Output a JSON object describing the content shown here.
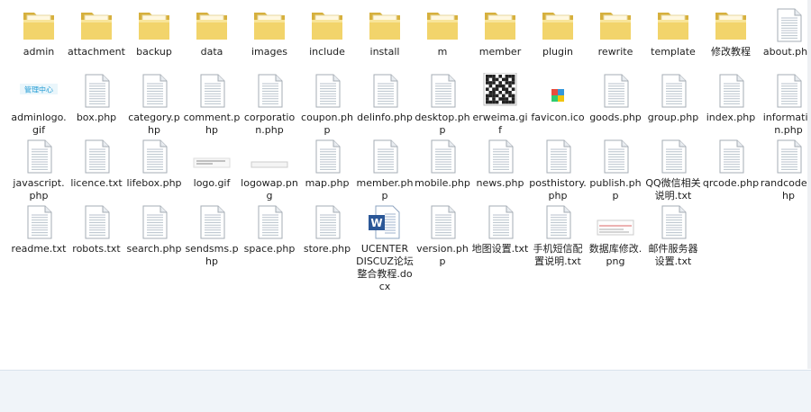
{
  "window": {
    "statusbar_text": ""
  },
  "colors": {
    "folder": "#f2d46b",
    "folder_dark": "#d6b03d",
    "page": "#ffffff",
    "page_line": "#b8c2cc",
    "status_bg": "#f0f4f9"
  },
  "files": [
    {
      "name": "admin",
      "icon": "folder-icon"
    },
    {
      "name": "attachment",
      "icon": "folder-icon"
    },
    {
      "name": "backup",
      "icon": "folder-icon"
    },
    {
      "name": "data",
      "icon": "folder-icon"
    },
    {
      "name": "images",
      "icon": "folder-icon"
    },
    {
      "name": "include",
      "icon": "folder-icon"
    },
    {
      "name": "install",
      "icon": "folder-icon"
    },
    {
      "name": "m",
      "icon": "folder-icon"
    },
    {
      "name": "member",
      "icon": "folder-icon"
    },
    {
      "name": "plugin",
      "icon": "folder-icon"
    },
    {
      "name": "rewrite",
      "icon": "folder-icon"
    },
    {
      "name": "template",
      "icon": "folder-icon"
    },
    {
      "name": "修改教程",
      "icon": "folder-icon"
    },
    {
      "name": "about.php",
      "icon": "file-icon"
    },
    {
      "name": "adminlogo.gif",
      "icon": "image-icon",
      "thumb_text": "管理中心"
    },
    {
      "name": "box.php",
      "icon": "file-icon"
    },
    {
      "name": "category.php",
      "icon": "file-icon"
    },
    {
      "name": "comment.php",
      "icon": "file-icon"
    },
    {
      "name": "corporation.php",
      "icon": "file-icon"
    },
    {
      "name": "coupon.php",
      "icon": "file-icon"
    },
    {
      "name": "delinfo.php",
      "icon": "file-icon"
    },
    {
      "name": "desktop.php",
      "icon": "file-icon"
    },
    {
      "name": "erweima.gif",
      "icon": "qrcode-icon"
    },
    {
      "name": "favicon.ico",
      "icon": "favicon-icon"
    },
    {
      "name": "goods.php",
      "icon": "file-icon"
    },
    {
      "name": "group.php",
      "icon": "file-icon"
    },
    {
      "name": "index.php",
      "icon": "file-icon"
    },
    {
      "name": "information.php",
      "icon": "file-icon"
    },
    {
      "name": "javascript.php",
      "icon": "file-icon"
    },
    {
      "name": "licence.txt",
      "icon": "file-icon"
    },
    {
      "name": "lifebox.php",
      "icon": "file-icon"
    },
    {
      "name": "logo.gif",
      "icon": "logo-image-icon"
    },
    {
      "name": "logowap.png",
      "icon": "logowap-image-icon"
    },
    {
      "name": "map.php",
      "icon": "file-icon"
    },
    {
      "name": "member.php",
      "icon": "file-icon"
    },
    {
      "name": "mobile.php",
      "icon": "file-icon"
    },
    {
      "name": "news.php",
      "icon": "file-icon"
    },
    {
      "name": "posthistory.php",
      "icon": "file-icon"
    },
    {
      "name": "publish.php",
      "icon": "file-icon"
    },
    {
      "name": "QQ微信相关说明.txt",
      "icon": "file-icon"
    },
    {
      "name": "qrcode.php",
      "icon": "file-icon"
    },
    {
      "name": "randcode.php",
      "icon": "file-icon"
    },
    {
      "name": "readme.txt",
      "icon": "file-icon"
    },
    {
      "name": "robots.txt",
      "icon": "file-icon"
    },
    {
      "name": "search.php",
      "icon": "file-icon"
    },
    {
      "name": "sendsms.php",
      "icon": "file-icon"
    },
    {
      "name": "space.php",
      "icon": "file-icon"
    },
    {
      "name": "store.php",
      "icon": "file-icon"
    },
    {
      "name": "UCENTER DISCUZ论坛整合教程.docx",
      "icon": "word-doc-icon"
    },
    {
      "name": "version.php",
      "icon": "file-icon"
    },
    {
      "name": "地图设置.txt",
      "icon": "file-icon"
    },
    {
      "name": "手机短信配置说明.txt",
      "icon": "file-icon"
    },
    {
      "name": "数据库修改.png",
      "icon": "screenshot-image-icon"
    },
    {
      "name": "邮件服务器设置.txt",
      "icon": "file-icon"
    }
  ]
}
